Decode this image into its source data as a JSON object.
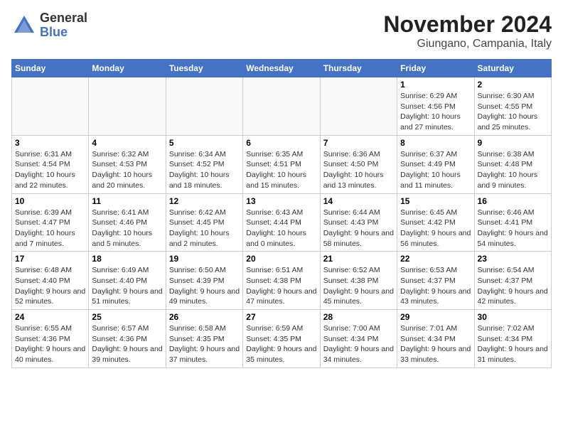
{
  "header": {
    "logo_general": "General",
    "logo_blue": "Blue",
    "title": "November 2024",
    "location": "Giungano, Campania, Italy"
  },
  "days_of_week": [
    "Sunday",
    "Monday",
    "Tuesday",
    "Wednesday",
    "Thursday",
    "Friday",
    "Saturday"
  ],
  "weeks": [
    [
      {
        "day": "",
        "info": ""
      },
      {
        "day": "",
        "info": ""
      },
      {
        "day": "",
        "info": ""
      },
      {
        "day": "",
        "info": ""
      },
      {
        "day": "",
        "info": ""
      },
      {
        "day": "1",
        "info": "Sunrise: 6:29 AM\nSunset: 4:56 PM\nDaylight: 10 hours and 27 minutes."
      },
      {
        "day": "2",
        "info": "Sunrise: 6:30 AM\nSunset: 4:55 PM\nDaylight: 10 hours and 25 minutes."
      }
    ],
    [
      {
        "day": "3",
        "info": "Sunrise: 6:31 AM\nSunset: 4:54 PM\nDaylight: 10 hours and 22 minutes."
      },
      {
        "day": "4",
        "info": "Sunrise: 6:32 AM\nSunset: 4:53 PM\nDaylight: 10 hours and 20 minutes."
      },
      {
        "day": "5",
        "info": "Sunrise: 6:34 AM\nSunset: 4:52 PM\nDaylight: 10 hours and 18 minutes."
      },
      {
        "day": "6",
        "info": "Sunrise: 6:35 AM\nSunset: 4:51 PM\nDaylight: 10 hours and 15 minutes."
      },
      {
        "day": "7",
        "info": "Sunrise: 6:36 AM\nSunset: 4:50 PM\nDaylight: 10 hours and 13 minutes."
      },
      {
        "day": "8",
        "info": "Sunrise: 6:37 AM\nSunset: 4:49 PM\nDaylight: 10 hours and 11 minutes."
      },
      {
        "day": "9",
        "info": "Sunrise: 6:38 AM\nSunset: 4:48 PM\nDaylight: 10 hours and 9 minutes."
      }
    ],
    [
      {
        "day": "10",
        "info": "Sunrise: 6:39 AM\nSunset: 4:47 PM\nDaylight: 10 hours and 7 minutes."
      },
      {
        "day": "11",
        "info": "Sunrise: 6:41 AM\nSunset: 4:46 PM\nDaylight: 10 hours and 5 minutes."
      },
      {
        "day": "12",
        "info": "Sunrise: 6:42 AM\nSunset: 4:45 PM\nDaylight: 10 hours and 2 minutes."
      },
      {
        "day": "13",
        "info": "Sunrise: 6:43 AM\nSunset: 4:44 PM\nDaylight: 10 hours and 0 minutes."
      },
      {
        "day": "14",
        "info": "Sunrise: 6:44 AM\nSunset: 4:43 PM\nDaylight: 9 hours and 58 minutes."
      },
      {
        "day": "15",
        "info": "Sunrise: 6:45 AM\nSunset: 4:42 PM\nDaylight: 9 hours and 56 minutes."
      },
      {
        "day": "16",
        "info": "Sunrise: 6:46 AM\nSunset: 4:41 PM\nDaylight: 9 hours and 54 minutes."
      }
    ],
    [
      {
        "day": "17",
        "info": "Sunrise: 6:48 AM\nSunset: 4:40 PM\nDaylight: 9 hours and 52 minutes."
      },
      {
        "day": "18",
        "info": "Sunrise: 6:49 AM\nSunset: 4:40 PM\nDaylight: 9 hours and 51 minutes."
      },
      {
        "day": "19",
        "info": "Sunrise: 6:50 AM\nSunset: 4:39 PM\nDaylight: 9 hours and 49 minutes."
      },
      {
        "day": "20",
        "info": "Sunrise: 6:51 AM\nSunset: 4:38 PM\nDaylight: 9 hours and 47 minutes."
      },
      {
        "day": "21",
        "info": "Sunrise: 6:52 AM\nSunset: 4:38 PM\nDaylight: 9 hours and 45 minutes."
      },
      {
        "day": "22",
        "info": "Sunrise: 6:53 AM\nSunset: 4:37 PM\nDaylight: 9 hours and 43 minutes."
      },
      {
        "day": "23",
        "info": "Sunrise: 6:54 AM\nSunset: 4:37 PM\nDaylight: 9 hours and 42 minutes."
      }
    ],
    [
      {
        "day": "24",
        "info": "Sunrise: 6:55 AM\nSunset: 4:36 PM\nDaylight: 9 hours and 40 minutes."
      },
      {
        "day": "25",
        "info": "Sunrise: 6:57 AM\nSunset: 4:36 PM\nDaylight: 9 hours and 39 minutes."
      },
      {
        "day": "26",
        "info": "Sunrise: 6:58 AM\nSunset: 4:35 PM\nDaylight: 9 hours and 37 minutes."
      },
      {
        "day": "27",
        "info": "Sunrise: 6:59 AM\nSunset: 4:35 PM\nDaylight: 9 hours and 35 minutes."
      },
      {
        "day": "28",
        "info": "Sunrise: 7:00 AM\nSunset: 4:34 PM\nDaylight: 9 hours and 34 minutes."
      },
      {
        "day": "29",
        "info": "Sunrise: 7:01 AM\nSunset: 4:34 PM\nDaylight: 9 hours and 33 minutes."
      },
      {
        "day": "30",
        "info": "Sunrise: 7:02 AM\nSunset: 4:34 PM\nDaylight: 9 hours and 31 minutes."
      }
    ]
  ]
}
